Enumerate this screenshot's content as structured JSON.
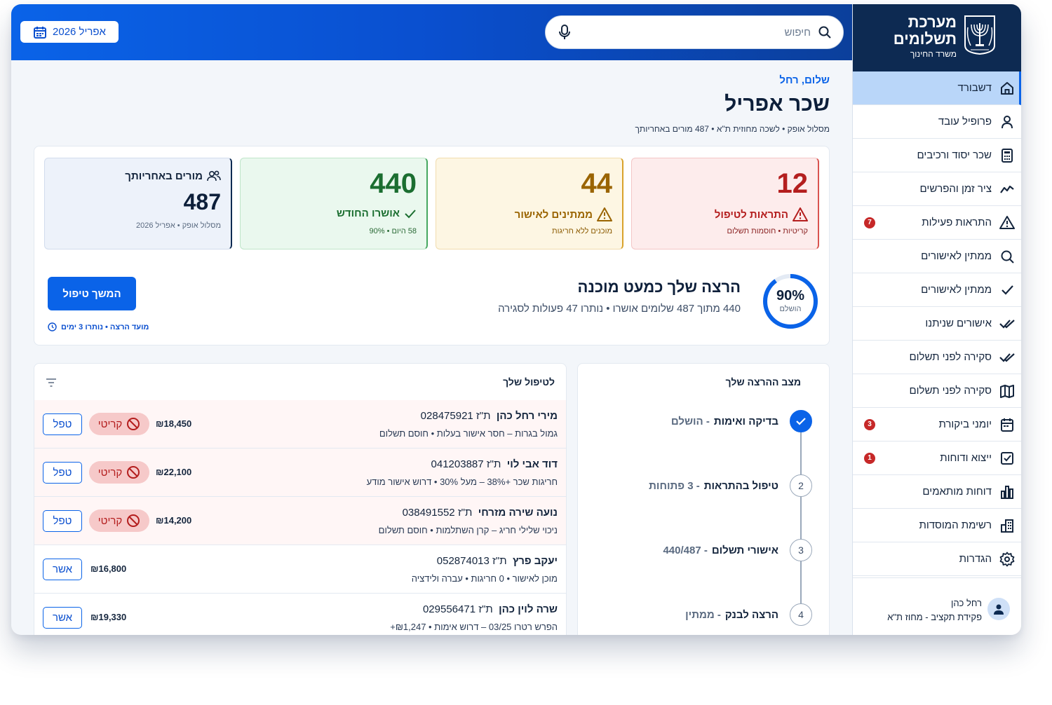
{
  "brand": {
    "title_line1": "מערכת",
    "title_line2": "תשלומים",
    "subtitle": "משרד החינוך"
  },
  "header": {
    "search_placeholder": "חיפוש",
    "date_label": "אפריל 2026"
  },
  "sidebar": {
    "items": [
      {
        "label": "דשבורד",
        "icon": "home-icon",
        "active": true
      },
      {
        "label": "פרופיל עובד",
        "icon": "user-icon"
      },
      {
        "label": "שכר יסוד ורכיבים",
        "icon": "calculator-icon"
      },
      {
        "label": "ציר זמן והפרשים",
        "icon": "trend-icon"
      },
      {
        "label": "התראות פעילות",
        "icon": "alert-icon",
        "badge": "7"
      },
      {
        "label": "ממתין לאישורים",
        "icon": "search-icon"
      },
      {
        "label": "ממתין לאישורים",
        "icon": "check-icon"
      },
      {
        "label": "אישורים שניתנו",
        "icon": "double-check-icon"
      },
      {
        "label": "סקירה לפני תשלום",
        "icon": "double-check-icon"
      },
      {
        "label": "סקירה לפני תשלום",
        "icon": "map-icon"
      },
      {
        "label": "יומני ביקורת",
        "icon": "calendar-icon",
        "badge": "3"
      },
      {
        "label": "ייצוא ודוחות",
        "icon": "checkbox-icon",
        "badge": "1"
      },
      {
        "label": "דוחות מותאמים",
        "icon": "bar-chart-icon"
      },
      {
        "label": "רשימת המוסדות",
        "icon": "building-icon"
      },
      {
        "label": "הגדרות",
        "icon": "gear-icon"
      }
    ],
    "user": {
      "name": "רחל כהן",
      "role": "פקידת תקציב - מחוז ת\"א"
    }
  },
  "main": {
    "greeting": "שלום, רחל",
    "title": "שכר אפריל",
    "subtitle": "מסלול אופק • לשכה מחוזית ת\"א • 487 מורים באחריותך"
  },
  "kpis": {
    "alerts": {
      "value": "12",
      "label": "התראות לטיפול",
      "sub": "קריטיות • חוסמות תשלום",
      "color": "#b41e1e"
    },
    "pending": {
      "value": "44",
      "label": "ממתינים לאישור",
      "sub": "מוכנים ללא חריגות",
      "color": "#9a6400"
    },
    "approved": {
      "value": "440",
      "label": "אושרו החודש",
      "sub": "58 היום • 90%",
      "color": "#1b6e30"
    },
    "teachers": {
      "value": "487",
      "label": "מורים באחריותך",
      "sub": "מסלול אופק • אפריל 2026"
    }
  },
  "progress": {
    "percent_label": "90%",
    "percent_value": 0.9,
    "caption": "הושלם",
    "title": "הרצה שלך כמעט מוכנה",
    "subtitle": "440 מתוך 487 שלומים אושרו • נותרו 47 פעולות לסגירה",
    "button": "המשך טיפול",
    "deadline": "מועד הרצה • נותרו 3 ימים"
  },
  "steps": {
    "title": "מצב ההרצה שלך",
    "items": [
      {
        "num": "",
        "label": "בדיקה ואימות",
        "status": "- הושלם",
        "done": true
      },
      {
        "num": "2",
        "label": "טיפול בהתראות",
        "status": "- 3 פתוחות"
      },
      {
        "num": "3",
        "label": "אישורי תשלום",
        "status": "- 440/487"
      },
      {
        "num": "4",
        "label": "הרצה לבנק",
        "status": "- ממתין"
      }
    ]
  },
  "tasks": {
    "title": "לטיפול שלך",
    "rows": [
      {
        "name": "מירי רחל כהן",
        "id": "ת\"ז 028475921",
        "desc": "גמול בגרות – חסר אישור בעלות • חוסם תשלום",
        "amount": "₪18,450",
        "chip": "קריטי",
        "action": "טפל",
        "critical": true
      },
      {
        "name": "דוד אבי לוי",
        "id": "ת\"ז 041203887",
        "desc": "חריגות שכר +38% – מעל 30% • דרוש אישור מודע",
        "amount": "₪22,100",
        "chip": "קריטי",
        "action": "טפל",
        "critical": true
      },
      {
        "name": "נועה שירה מזרחי",
        "id": "ת\"ז 038491552",
        "desc": "ניכוי שלילי חריג – קרן השתלמות • חוסם תשלום",
        "amount": "₪14,200",
        "chip": "קריטי",
        "action": "טפל",
        "critical": true
      },
      {
        "name": "יעקב פרץ",
        "id": "ת\"ז 052874013",
        "desc": "מוכן לאישור • 0 חריגות • עברה ולידציה",
        "amount": "₪16,800",
        "chip": "",
        "action": "אשר",
        "critical": false
      },
      {
        "name": "שרה לוין כהן",
        "id": "ת\"ז 029556471",
        "desc": "הפרש רטרו 03/25 – דרוש אימות • ₪1,247+",
        "amount": "₪19,330",
        "chip": "",
        "action": "אשר",
        "critical": false
      }
    ]
  }
}
